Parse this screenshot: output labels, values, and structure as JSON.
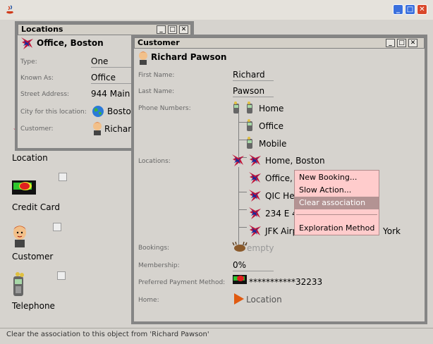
{
  "main_window": {
    "buttons": {
      "minimize": "_",
      "maximize": "□",
      "close": "✕"
    }
  },
  "desktop_icons": [
    {
      "label": "Location"
    },
    {
      "label": "Credit Card"
    },
    {
      "label": "Customer"
    },
    {
      "label": "Telephone"
    }
  ],
  "locations_window": {
    "title": "Locations",
    "header": "Office, Boston",
    "fields": [
      {
        "label": "Type:",
        "value": "One"
      },
      {
        "label": "Known As:",
        "value": "Office"
      },
      {
        "label": "Street Address:",
        "value": "944 Main"
      },
      {
        "label": "City for this location:",
        "value": "Bosto"
      },
      {
        "label": "Customer:",
        "value": "Richard"
      }
    ]
  },
  "customer_window": {
    "title": "Customer",
    "header": "Richard Pawson",
    "first_name": {
      "label": "First Name:",
      "value": "Richard"
    },
    "last_name": {
      "label": "Last Name:",
      "value": "Pawson"
    },
    "phone_numbers": {
      "label": "Phone Numbers:",
      "items": [
        "Home",
        "Office",
        "Mobile"
      ]
    },
    "locations": {
      "label": "Locations:",
      "items": [
        "Home, Boston",
        "Office, E",
        "QIC Hea",
        "234 E 4",
        "JFK Airp"
      ],
      "trailing_text": "York"
    },
    "bookings": {
      "label": "Bookings:",
      "value": "empty"
    },
    "membership": {
      "label": "Membership:",
      "value": "0%"
    },
    "payment": {
      "label": "Preferred Payment Method:",
      "value": "***********32233"
    },
    "home": {
      "label": "Home:",
      "value": "Location"
    }
  },
  "context_menu": {
    "items": [
      "New Booking...",
      "Slow Action...",
      "Clear association"
    ],
    "separator_item": "Exploration Method",
    "highlighted": "Clear association"
  },
  "status": "Clear the association to this object from 'Richard Pawson'",
  "colors": {
    "menu_bg": "#ffcccc",
    "menu_highlight": "#b39393",
    "window_frame": "#858585"
  }
}
